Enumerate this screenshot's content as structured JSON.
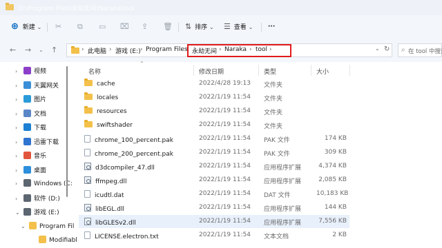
{
  "window": {
    "title": "D:\\Program Files\\永劫无间\\Naraka\\tool"
  },
  "toolbar": {
    "new_label": "新建",
    "sort_label": "排序",
    "view_label": "查看",
    "more_label": "···"
  },
  "address": {
    "crumbs": [
      "此电脑",
      "游戏 (E:)",
      "Program Files",
      "永劫无间",
      "Naraka",
      "tool"
    ]
  },
  "search": {
    "placeholder": "在 tool 中搜索"
  },
  "sidebar": {
    "items": [
      {
        "label": "视频",
        "icon": "video-icon",
        "color": "#8b3fc9"
      },
      {
        "label": "天翼网关",
        "icon": "cloud-gateway-icon",
        "color": "#3b8fd8"
      },
      {
        "label": "图片",
        "icon": "pictures-icon",
        "color": "#2a9bd8"
      },
      {
        "label": "文档",
        "icon": "documents-icon",
        "color": "#5a86c8"
      },
      {
        "label": "下载",
        "icon": "download-icon",
        "color": "#1b7fd3"
      },
      {
        "label": "迅雷下载",
        "icon": "xunlei-icon",
        "color": "#2f74d0"
      },
      {
        "label": "音乐",
        "icon": "music-icon",
        "color": "#e2553d"
      },
      {
        "label": "桌面",
        "icon": "desktop-icon",
        "color": "#2d8fdc"
      },
      {
        "label": "Windows (C:",
        "icon": "drive-icon",
        "color": "#5c6670"
      },
      {
        "label": "软件 (D:)",
        "icon": "drive-icon",
        "color": "#5c6670"
      },
      {
        "label": "游戏 (E:)",
        "icon": "drive-icon",
        "color": "#5c6670"
      },
      {
        "label": "Program Fil",
        "icon": "folder-icon",
        "color": "#f3c04a"
      },
      {
        "label": "Modifiabl",
        "icon": "folder-icon",
        "color": "#f3c04a"
      }
    ]
  },
  "columns": {
    "name": "名称",
    "date": "修改日期",
    "type": "类型",
    "size": "大小"
  },
  "files": [
    {
      "name": "cache",
      "date": "2022/4/28 19:13",
      "type": "文件夹",
      "size": "",
      "kind": "folder"
    },
    {
      "name": "locales",
      "date": "2022/1/19 11:54",
      "type": "文件夹",
      "size": "",
      "kind": "folder"
    },
    {
      "name": "resources",
      "date": "2022/1/19 11:54",
      "type": "文件夹",
      "size": "",
      "kind": "folder"
    },
    {
      "name": "swiftshader",
      "date": "2022/1/19 11:54",
      "type": "文件夹",
      "size": "",
      "kind": "folder"
    },
    {
      "name": "chrome_100_percent.pak",
      "date": "2022/1/19 11:54",
      "type": "PAK 文件",
      "size": "174 KB",
      "kind": "file"
    },
    {
      "name": "chrome_200_percent.pak",
      "date": "2022/1/19 11:54",
      "type": "PAK 文件",
      "size": "309 KB",
      "kind": "file"
    },
    {
      "name": "d3dcompiler_47.dll",
      "date": "2022/1/19 11:54",
      "type": "应用程序扩展",
      "size": "4,374 KB",
      "kind": "dll"
    },
    {
      "name": "ffmpeg.dll",
      "date": "2022/1/19 11:54",
      "type": "应用程序扩展",
      "size": "2,085 KB",
      "kind": "dll"
    },
    {
      "name": "icudtl.dat",
      "date": "2022/1/19 11:54",
      "type": "DAT 文件",
      "size": "10,183 KB",
      "kind": "file"
    },
    {
      "name": "libEGL.dll",
      "date": "2022/1/19 11:54",
      "type": "应用程序扩展",
      "size": "144 KB",
      "kind": "dll"
    },
    {
      "name": "libGLESv2.dll",
      "date": "2022/1/19 11:54",
      "type": "应用程序扩展",
      "size": "7,556 KB",
      "kind": "dll",
      "selected": true
    },
    {
      "name": "LICENSE.electron.txt",
      "date": "2022/1/19 11:54",
      "type": "文本文档",
      "size": "2 KB",
      "kind": "file"
    }
  ]
}
